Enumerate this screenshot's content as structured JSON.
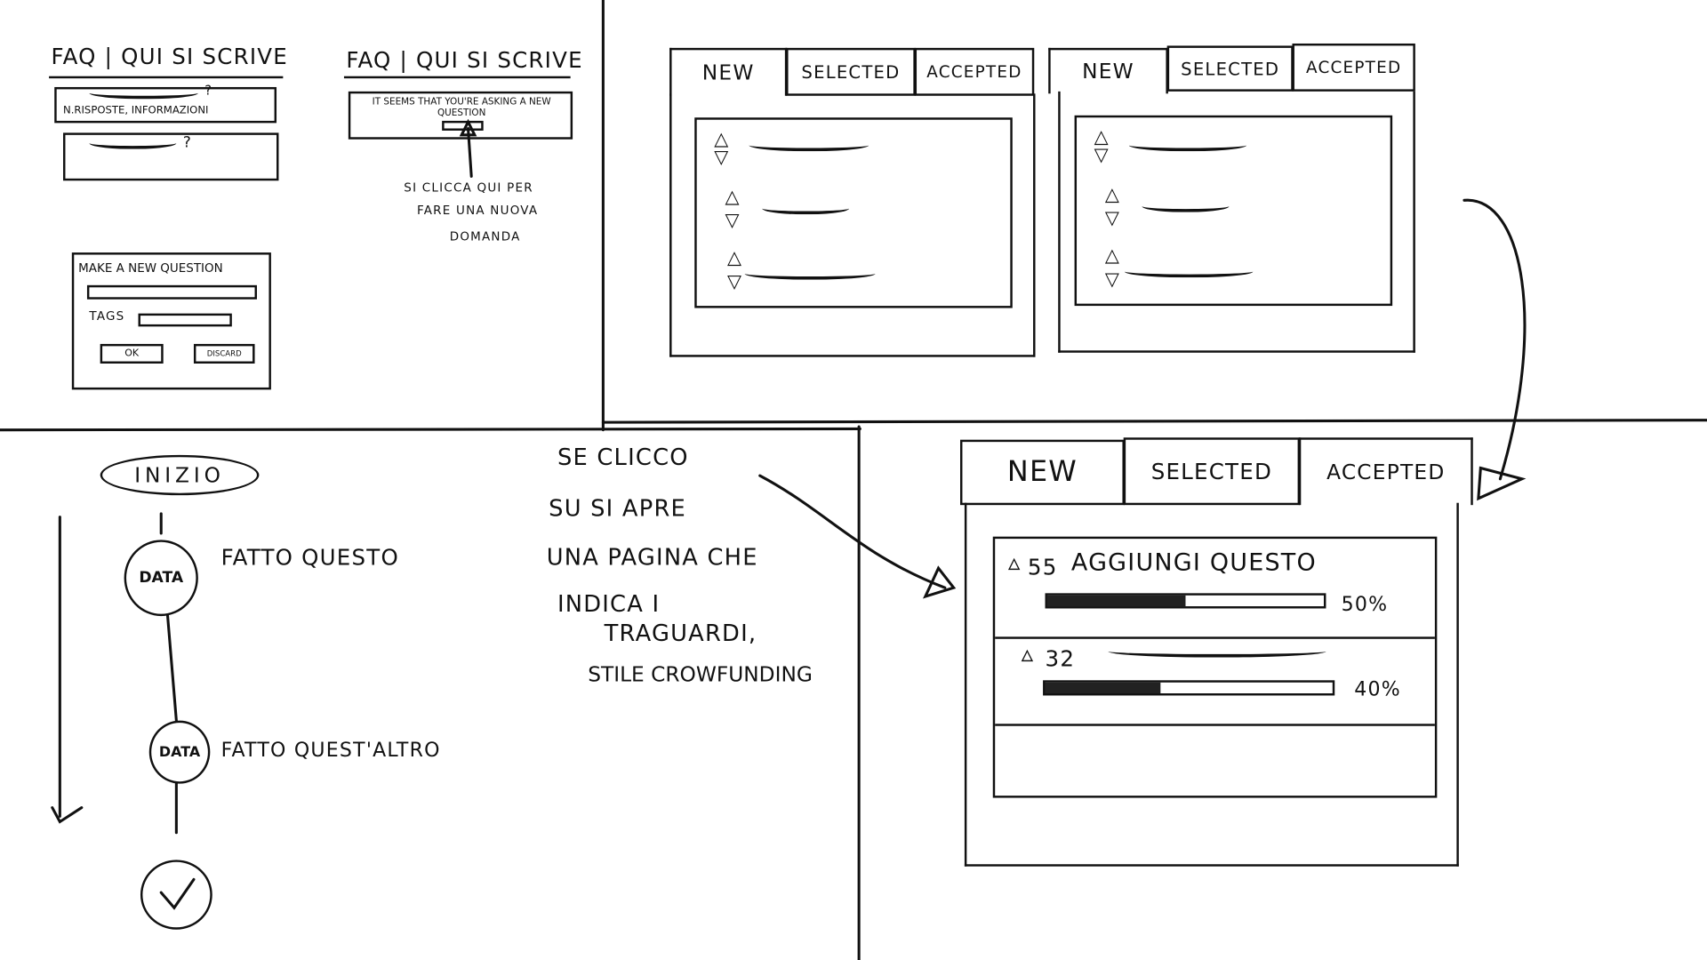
{
  "faq_panel_1": {
    "title": "FAQ | QUI SI SCRIVE",
    "question_1_info": "N.RISPOSTE, INFORMAZIONI",
    "question_mark": "?"
  },
  "new_question_dialog": {
    "title": "MAKE A NEW QUESTION",
    "tags_label": "TAGS",
    "ok_label": "OK",
    "discard_label": "DISCARD"
  },
  "faq_panel_2": {
    "title": "FAQ | QUI SI SCRIVE",
    "notice": "IT SEEMS THAT YOU'RE ASKING A NEW QUESTION",
    "annotation": [
      "SI CLICCA QUI PER",
      "FARE UNA NUOVA",
      "DOMANDA"
    ]
  },
  "tabs": [
    "NEW",
    "SELECTED",
    "ACCEPTED"
  ],
  "timeline": {
    "start_label": "INIZIO",
    "steps": [
      {
        "date": "DATA",
        "text": "FATTO QUESTO"
      },
      {
        "date": "DATA",
        "text": "FATTO QUEST'ALTRO"
      }
    ]
  },
  "middle_note": [
    "SE CLICCO",
    "SU SI APRE",
    "UNA PAGINA CHE",
    "INDICA I",
    "TRAGUARDI,",
    "STILE CROWFUNDING"
  ],
  "accepted_list": [
    {
      "votes": "55",
      "title": "AGGIUNGI QUESTO",
      "progress_label": "50%",
      "progress": 50
    },
    {
      "votes": "32",
      "title": "",
      "progress_label": "40%",
      "progress": 40
    }
  ]
}
